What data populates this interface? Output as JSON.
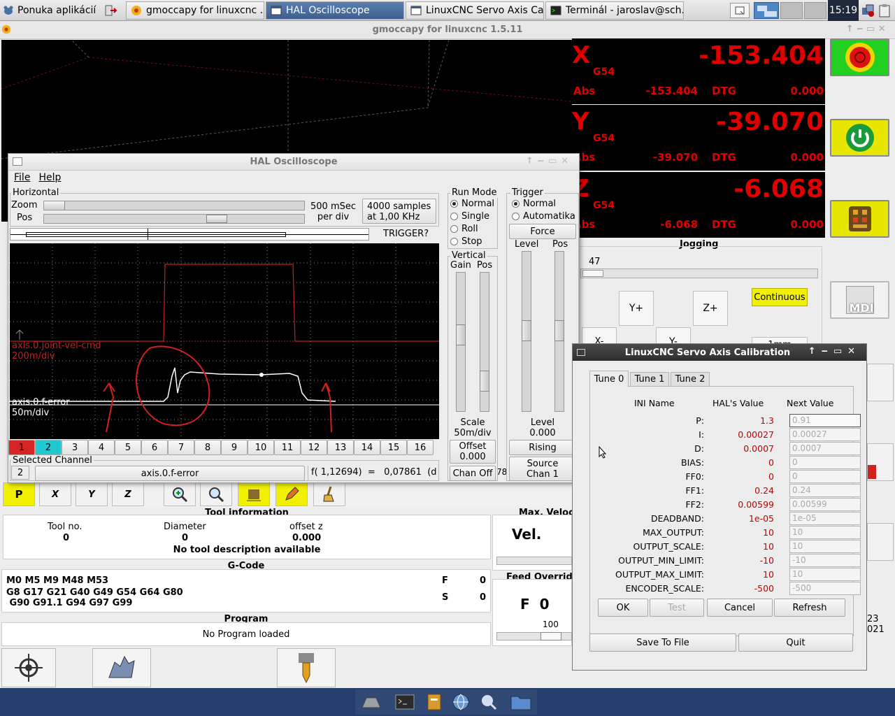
{
  "taskbar": {
    "start_label": "Ponuka aplikácií",
    "tasks": [
      {
        "label": "gmoccapy for linuxcnc  ..."
      },
      {
        "label": "HAL Oscilloscope"
      },
      {
        "label": "LinuxCNC Servo Axis Ca..."
      },
      {
        "label": "Terminál - jaroslav@sch..."
      }
    ],
    "clock": "15:19"
  },
  "gmoccapy": {
    "title": "gmoccapy for linuxcnc  1.5.11",
    "dro": [
      {
        "axis": "X",
        "system": "G54",
        "value": "-153.404",
        "abs_label": "Abs",
        "abs": "-153.404",
        "dtg_label": "DTG",
        "dtg": "0.000"
      },
      {
        "axis": "Y",
        "system": "G54",
        "value": "-39.070",
        "abs_label": "Abs",
        "abs": "-39.070",
        "dtg_label": "DTG",
        "dtg": "0.000"
      },
      {
        "axis": "Z",
        "system": "G54",
        "value": "-6.068",
        "abs_label": "Abs",
        "abs": "-6.068",
        "dtg_label": "DTG",
        "dtg": "0.000"
      }
    ],
    "jogging": {
      "title": "Jogging",
      "velocity": "47",
      "yplus": "Y+",
      "zplus": "Z+",
      "continuous": "Continuous",
      "yminus_partial": "Y-",
      "zminus_partial": "Z-",
      "inc_partial": "1mm",
      "mdi": "MDI"
    },
    "tool": {
      "title": "Tool information",
      "tool_no_label": "Tool no.",
      "tool_no": "0",
      "diameter_label": "Diameter",
      "diameter": "0",
      "offset_label": "offset z",
      "offset": "0.000",
      "desc": "No tool description available"
    },
    "gcode": {
      "title": "G-Code",
      "line1": "M0 M5 M9 M48 M53",
      "line2": "G8 G17 G21 G40 G49 G54 G64 G80",
      "line3": " G90 G91.1 G94 G97 G99",
      "f_label": "F",
      "f_value": "0",
      "s_label": "S",
      "s_value": "0"
    },
    "program": {
      "title": "Program",
      "text": "No Program loaded"
    },
    "max_velocity": {
      "title": "Max. Veloc",
      "label": "Vel."
    },
    "feed_override": {
      "title": "Feed Overrid",
      "label": "F  0",
      "scale": "100"
    },
    "date_partial": {
      "line1": "23",
      "line2": "021"
    }
  },
  "scope": {
    "title": "HAL Oscilloscope",
    "menu": {
      "file": "File",
      "help": "Help"
    },
    "horizontal": {
      "title": "Horizontal",
      "zoom_label": "Zoom",
      "pos_label": "Pos",
      "rate_line1": "500 mSec",
      "rate_line2": "per div",
      "samples_line1": "4000 samples",
      "samples_line2": "at 1,00 KHz",
      "trigger_status": "TRIGGER?"
    },
    "run_mode": {
      "title": "Run Mode",
      "options": [
        {
          "label": "Normal",
          "selected": true
        },
        {
          "label": "Single",
          "selected": false
        },
        {
          "label": "Roll",
          "selected": false
        },
        {
          "label": "Stop",
          "selected": false
        }
      ]
    },
    "trigger": {
      "title": "Trigger",
      "normal": "Normal",
      "auto": "Automatika",
      "force": "Force",
      "level_label": "Level",
      "pos_label": "Pos",
      "level_text": "Level",
      "level_value": "0.000",
      "edge": "Rising",
      "source_line1": "Source",
      "source_line2": "Chan  1"
    },
    "vertical": {
      "title": "Vertical",
      "gain_label": "Gain",
      "pos_label": "Pos",
      "scale_label": "Scale",
      "scale_value": "50m/div",
      "offset_label": "Offset",
      "offset_value": "0.000",
      "chan_off": "Chan Off"
    },
    "traces": [
      {
        "name": "axis.0.joint-vel-cmd",
        "scale": "200m/div",
        "color": "#c02020"
      },
      {
        "name": "axis.0.f-error",
        "scale": "50m/div",
        "color": "#ffffff"
      }
    ],
    "channels": [
      "1",
      "2",
      "3",
      "4",
      "5",
      "6",
      "7",
      "8",
      "9",
      "10",
      "11",
      "12",
      "13",
      "14",
      "15",
      "16"
    ],
    "selected_channel": {
      "title": "Selected Channel",
      "number": "2",
      "name": "axis.0.f-error",
      "readout": "f( 1,12694)  =   0,07861  (d",
      "readout_tail": "78"
    }
  },
  "calibration": {
    "title": "LinuxCNC Servo Axis Calibration",
    "tabs": [
      "Tune 0",
      "Tune 1",
      "Tune 2"
    ],
    "headers": {
      "ini": "INI Name",
      "hal": "HAL's Value",
      "next": "Next Value"
    },
    "params": [
      {
        "name": "P:",
        "hal": "1.3",
        "next": "0.91"
      },
      {
        "name": "I:",
        "hal": "0.00027",
        "next": "0.00027"
      },
      {
        "name": "D:",
        "hal": "0.0007",
        "next": "0.0007"
      },
      {
        "name": "BIAS:",
        "hal": "0",
        "next": "0"
      },
      {
        "name": "FF0:",
        "hal": "0",
        "next": "0"
      },
      {
        "name": "FF1:",
        "hal": "0.24",
        "next": "0.24"
      },
      {
        "name": "FF2:",
        "hal": "0.00599",
        "next": "0.00599"
      },
      {
        "name": "DEADBAND:",
        "hal": "1e-05",
        "next": "1e-05"
      },
      {
        "name": "MAX_OUTPUT:",
        "hal": "10",
        "next": "10"
      },
      {
        "name": "OUTPUT_SCALE:",
        "hal": "10",
        "next": "10"
      },
      {
        "name": "OUTPUT_MIN_LIMIT:",
        "hal": "-10",
        "next": "-10"
      },
      {
        "name": "OUTPUT_MAX_LIMIT:",
        "hal": "10",
        "next": "10"
      },
      {
        "name": "ENCODER_SCALE:",
        "hal": "-500",
        "next": "-500"
      }
    ],
    "buttons": {
      "ok": "OK",
      "test": "Test",
      "cancel": "Cancel",
      "refresh": "Refresh",
      "save": "Save To File",
      "quit": "Quit"
    }
  }
}
